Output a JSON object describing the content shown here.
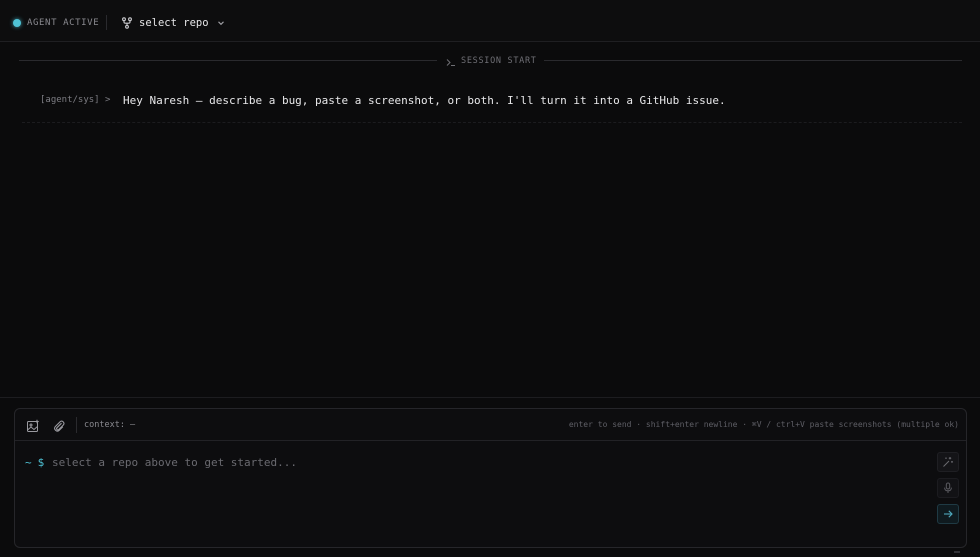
{
  "topbar": {
    "status_label": "AGENT ACTIVE",
    "status_color": "#4fc3d6",
    "repo_icon": "git-fork-icon",
    "repo_label": "select repo",
    "repo_chevron_icon": "chevron-down-icon"
  },
  "session": {
    "icon": "terminal-icon",
    "label": "SESSION START"
  },
  "messages": [
    {
      "prefix": "[agent/sys] >",
      "text": "Hey Naresh — describe a bug, paste a screenshot, or both. I'll turn it into a GitHub issue."
    }
  ],
  "composer": {
    "image_icon": "image-icon",
    "attach_icon": "paperclip-icon",
    "context_label": "context: —",
    "hints": "enter to send · shift+enter newline · ⌘V / ctrl+V paste screenshots (multiple ok)",
    "prompt_tilde": "~",
    "prompt_dollar": "$",
    "placeholder": "select a repo above to get started...",
    "value": "",
    "magic_icon": "sparkle-icon",
    "mic_icon": "mic-icon",
    "send_icon": "arrow-right-icon",
    "accent_color": "#4fc3d6"
  }
}
